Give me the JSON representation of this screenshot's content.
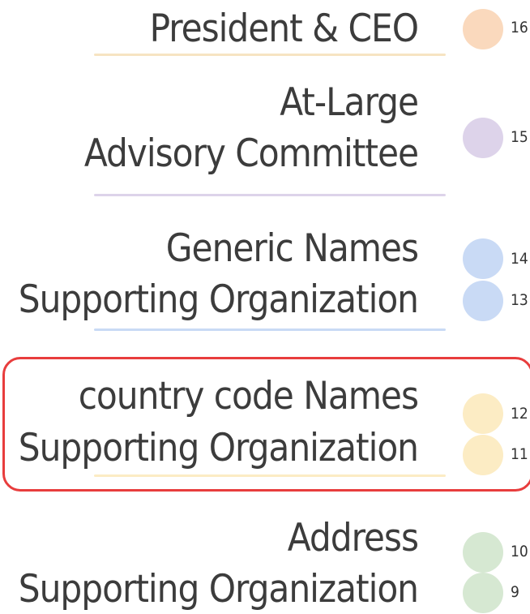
{
  "groups": [
    {
      "key": "ceo",
      "lines": [
        "President & CEO"
      ],
      "color": "#fad9bd",
      "seats": [
        "16"
      ]
    },
    {
      "key": "alac",
      "lines": [
        "At-Large",
        "Advisory Committee"
      ],
      "color": "#ddd3ea",
      "seats": [
        "15"
      ]
    },
    {
      "key": "gnso",
      "lines": [
        "Generic Names",
        "Supporting Organization"
      ],
      "color": "#c9daf5",
      "seats": [
        "14",
        "13"
      ]
    },
    {
      "key": "ccnso",
      "lines": [
        "country code Names",
        "Supporting Organization"
      ],
      "color": "#fcecc4",
      "seats": [
        "12",
        "11"
      ]
    },
    {
      "key": "aso",
      "lines": [
        "Address",
        "Supporting Organization"
      ],
      "color": "#d6e8d2",
      "seats": [
        "10",
        "9"
      ]
    }
  ],
  "highlight_color": "#e83d3d"
}
